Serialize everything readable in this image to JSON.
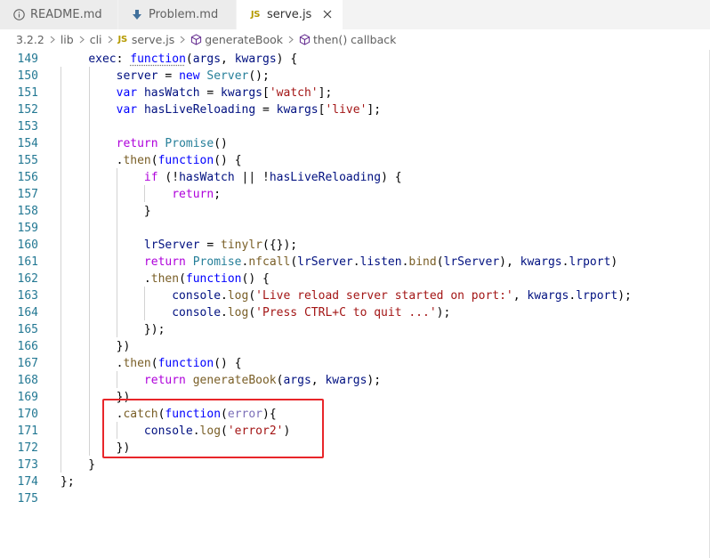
{
  "tabs": [
    {
      "label": "README.md",
      "icon": "info-icon",
      "active": false
    },
    {
      "label": "Problem.md",
      "icon": "download-arrow-icon",
      "active": false
    },
    {
      "label": "serve.js",
      "icon": "js-file-icon",
      "active": true
    }
  ],
  "js_badge": "JS",
  "close_glyph": "×",
  "breadcrumb": [
    {
      "label": "3.2.2",
      "icon": null
    },
    {
      "label": "lib",
      "icon": null
    },
    {
      "label": "cli",
      "icon": null
    },
    {
      "label": "serve.js",
      "icon": "js-file-icon"
    },
    {
      "label": "generateBook",
      "icon": "method-cube-icon"
    },
    {
      "label": "then() callback",
      "icon": "method-cube-icon"
    }
  ],
  "editor": {
    "lines": [
      {
        "no": "149",
        "tokens": [
          [
            "p",
            "    "
          ],
          [
            "v",
            "exec"
          ],
          [
            "p",
            ": "
          ],
          [
            "k squig",
            "function"
          ],
          [
            "p",
            "("
          ],
          [
            "v",
            "args"
          ],
          [
            "p",
            ", "
          ],
          [
            "v",
            "kwargs"
          ],
          [
            "p",
            ") {"
          ]
        ]
      },
      {
        "no": "150",
        "tokens": [
          [
            "p",
            "        "
          ],
          [
            "v",
            "server"
          ],
          [
            "p",
            " = "
          ],
          [
            "k",
            "new"
          ],
          [
            "p",
            " "
          ],
          [
            "t",
            "Server"
          ],
          [
            "p",
            "();"
          ]
        ]
      },
      {
        "no": "151",
        "tokens": [
          [
            "p",
            "        "
          ],
          [
            "k",
            "var"
          ],
          [
            "p",
            " "
          ],
          [
            "v",
            "hasWatch"
          ],
          [
            "p",
            " = "
          ],
          [
            "v",
            "kwargs"
          ],
          [
            "p",
            "["
          ],
          [
            "s",
            "'watch'"
          ],
          [
            "p",
            "];"
          ]
        ]
      },
      {
        "no": "152",
        "tokens": [
          [
            "p",
            "        "
          ],
          [
            "k",
            "var"
          ],
          [
            "p",
            " "
          ],
          [
            "v",
            "hasLiveReloading"
          ],
          [
            "p",
            " = "
          ],
          [
            "v",
            "kwargs"
          ],
          [
            "p",
            "["
          ],
          [
            "s",
            "'live'"
          ],
          [
            "p",
            "];"
          ]
        ]
      },
      {
        "no": "153",
        "tokens": []
      },
      {
        "no": "154",
        "tokens": [
          [
            "p",
            "        "
          ],
          [
            "c",
            "return"
          ],
          [
            "p",
            " "
          ],
          [
            "t",
            "Promise"
          ],
          [
            "p",
            "()"
          ]
        ]
      },
      {
        "no": "155",
        "tokens": [
          [
            "p",
            "        ."
          ],
          [
            "f",
            "then"
          ],
          [
            "p",
            "("
          ],
          [
            "k",
            "function"
          ],
          [
            "p",
            "() {"
          ]
        ]
      },
      {
        "no": "156",
        "tokens": [
          [
            "p",
            "            "
          ],
          [
            "c",
            "if"
          ],
          [
            "p",
            " (!"
          ],
          [
            "v",
            "hasWatch"
          ],
          [
            "p",
            " || !"
          ],
          [
            "v",
            "hasLiveReloading"
          ],
          [
            "p",
            ") {"
          ]
        ]
      },
      {
        "no": "157",
        "tokens": [
          [
            "p",
            "                "
          ],
          [
            "c",
            "return"
          ],
          [
            "p",
            ";"
          ]
        ]
      },
      {
        "no": "158",
        "tokens": [
          [
            "p",
            "            }"
          ]
        ]
      },
      {
        "no": "159",
        "tokens": []
      },
      {
        "no": "160",
        "tokens": [
          [
            "p",
            "            "
          ],
          [
            "v",
            "lrServer"
          ],
          [
            "p",
            " = "
          ],
          [
            "f",
            "tinylr"
          ],
          [
            "p",
            "({});"
          ]
        ]
      },
      {
        "no": "161",
        "tokens": [
          [
            "p",
            "            "
          ],
          [
            "c",
            "return"
          ],
          [
            "p",
            " "
          ],
          [
            "t",
            "Promise"
          ],
          [
            "p",
            "."
          ],
          [
            "f",
            "nfcall"
          ],
          [
            "p",
            "("
          ],
          [
            "v",
            "lrServer"
          ],
          [
            "p",
            "."
          ],
          [
            "v",
            "listen"
          ],
          [
            "p",
            "."
          ],
          [
            "f",
            "bind"
          ],
          [
            "p",
            "("
          ],
          [
            "v",
            "lrServer"
          ],
          [
            "p",
            "), "
          ],
          [
            "v",
            "kwargs"
          ],
          [
            "p",
            "."
          ],
          [
            "v",
            "lrport"
          ],
          [
            "p",
            ")"
          ]
        ]
      },
      {
        "no": "162",
        "tokens": [
          [
            "p",
            "            ."
          ],
          [
            "f",
            "then"
          ],
          [
            "p",
            "("
          ],
          [
            "k",
            "function"
          ],
          [
            "p",
            "() {"
          ]
        ]
      },
      {
        "no": "163",
        "tokens": [
          [
            "p",
            "                "
          ],
          [
            "v",
            "console"
          ],
          [
            "p",
            "."
          ],
          [
            "f",
            "log"
          ],
          [
            "p",
            "("
          ],
          [
            "s",
            "'Live reload server started on port:'"
          ],
          [
            "p",
            ", "
          ],
          [
            "v",
            "kwargs"
          ],
          [
            "p",
            "."
          ],
          [
            "v",
            "lrport"
          ],
          [
            "p",
            ");"
          ]
        ]
      },
      {
        "no": "164",
        "tokens": [
          [
            "p",
            "                "
          ],
          [
            "v",
            "console"
          ],
          [
            "p",
            "."
          ],
          [
            "f",
            "log"
          ],
          [
            "p",
            "("
          ],
          [
            "s",
            "'Press CTRL+C to quit ...'"
          ],
          [
            "p",
            ");"
          ]
        ]
      },
      {
        "no": "165",
        "tokens": [
          [
            "p",
            "            });"
          ]
        ]
      },
      {
        "no": "166",
        "tokens": [
          [
            "p",
            "        })"
          ]
        ]
      },
      {
        "no": "167",
        "tokens": [
          [
            "p",
            "        ."
          ],
          [
            "f",
            "then"
          ],
          [
            "p",
            "("
          ],
          [
            "k",
            "function"
          ],
          [
            "p",
            "() {"
          ]
        ]
      },
      {
        "no": "168",
        "tokens": [
          [
            "p",
            "            "
          ],
          [
            "c",
            "return"
          ],
          [
            "p",
            " "
          ],
          [
            "f",
            "generateBook"
          ],
          [
            "p",
            "("
          ],
          [
            "v",
            "args"
          ],
          [
            "p",
            ", "
          ],
          [
            "v",
            "kwargs"
          ],
          [
            "p",
            ");"
          ]
        ]
      },
      {
        "no": "169",
        "tokens": [
          [
            "p",
            "        })"
          ]
        ]
      },
      {
        "no": "170",
        "tokens": [
          [
            "p",
            "        ."
          ],
          [
            "f",
            "catch"
          ],
          [
            "p",
            "("
          ],
          [
            "k",
            "function"
          ],
          [
            "p",
            "("
          ],
          [
            "err",
            "error"
          ],
          [
            "p",
            "){"
          ]
        ]
      },
      {
        "no": "171",
        "tokens": [
          [
            "p",
            "            "
          ],
          [
            "v",
            "console"
          ],
          [
            "p",
            "."
          ],
          [
            "f",
            "log"
          ],
          [
            "p",
            "("
          ],
          [
            "s",
            "'error2'"
          ],
          [
            "p",
            ")"
          ]
        ]
      },
      {
        "no": "172",
        "tokens": [
          [
            "p",
            "        })"
          ]
        ]
      },
      {
        "no": "173",
        "tokens": [
          [
            "p",
            "    }"
          ]
        ]
      },
      {
        "no": "174",
        "tokens": [
          [
            "p",
            "};"
          ]
        ]
      },
      {
        "no": "175",
        "tokens": []
      }
    ]
  }
}
